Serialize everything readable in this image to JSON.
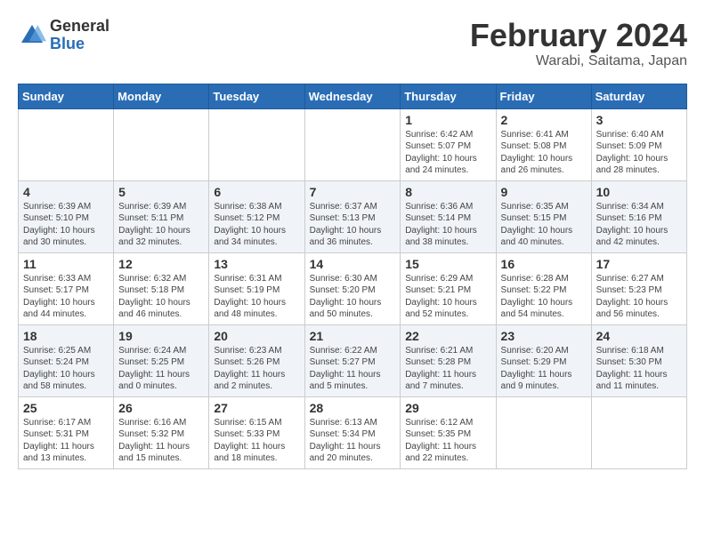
{
  "logo": {
    "general": "General",
    "blue": "Blue"
  },
  "title": "February 2024",
  "location": "Warabi, Saitama, Japan",
  "days_header": [
    "Sunday",
    "Monday",
    "Tuesday",
    "Wednesday",
    "Thursday",
    "Friday",
    "Saturday"
  ],
  "weeks": [
    [
      {
        "day": "",
        "info": ""
      },
      {
        "day": "",
        "info": ""
      },
      {
        "day": "",
        "info": ""
      },
      {
        "day": "",
        "info": ""
      },
      {
        "day": "1",
        "info": "Sunrise: 6:42 AM\nSunset: 5:07 PM\nDaylight: 10 hours\nand 24 minutes."
      },
      {
        "day": "2",
        "info": "Sunrise: 6:41 AM\nSunset: 5:08 PM\nDaylight: 10 hours\nand 26 minutes."
      },
      {
        "day": "3",
        "info": "Sunrise: 6:40 AM\nSunset: 5:09 PM\nDaylight: 10 hours\nand 28 minutes."
      }
    ],
    [
      {
        "day": "4",
        "info": "Sunrise: 6:39 AM\nSunset: 5:10 PM\nDaylight: 10 hours\nand 30 minutes."
      },
      {
        "day": "5",
        "info": "Sunrise: 6:39 AM\nSunset: 5:11 PM\nDaylight: 10 hours\nand 32 minutes."
      },
      {
        "day": "6",
        "info": "Sunrise: 6:38 AM\nSunset: 5:12 PM\nDaylight: 10 hours\nand 34 minutes."
      },
      {
        "day": "7",
        "info": "Sunrise: 6:37 AM\nSunset: 5:13 PM\nDaylight: 10 hours\nand 36 minutes."
      },
      {
        "day": "8",
        "info": "Sunrise: 6:36 AM\nSunset: 5:14 PM\nDaylight: 10 hours\nand 38 minutes."
      },
      {
        "day": "9",
        "info": "Sunrise: 6:35 AM\nSunset: 5:15 PM\nDaylight: 10 hours\nand 40 minutes."
      },
      {
        "day": "10",
        "info": "Sunrise: 6:34 AM\nSunset: 5:16 PM\nDaylight: 10 hours\nand 42 minutes."
      }
    ],
    [
      {
        "day": "11",
        "info": "Sunrise: 6:33 AM\nSunset: 5:17 PM\nDaylight: 10 hours\nand 44 minutes."
      },
      {
        "day": "12",
        "info": "Sunrise: 6:32 AM\nSunset: 5:18 PM\nDaylight: 10 hours\nand 46 minutes."
      },
      {
        "day": "13",
        "info": "Sunrise: 6:31 AM\nSunset: 5:19 PM\nDaylight: 10 hours\nand 48 minutes."
      },
      {
        "day": "14",
        "info": "Sunrise: 6:30 AM\nSunset: 5:20 PM\nDaylight: 10 hours\nand 50 minutes."
      },
      {
        "day": "15",
        "info": "Sunrise: 6:29 AM\nSunset: 5:21 PM\nDaylight: 10 hours\nand 52 minutes."
      },
      {
        "day": "16",
        "info": "Sunrise: 6:28 AM\nSunset: 5:22 PM\nDaylight: 10 hours\nand 54 minutes."
      },
      {
        "day": "17",
        "info": "Sunrise: 6:27 AM\nSunset: 5:23 PM\nDaylight: 10 hours\nand 56 minutes."
      }
    ],
    [
      {
        "day": "18",
        "info": "Sunrise: 6:25 AM\nSunset: 5:24 PM\nDaylight: 10 hours\nand 58 minutes."
      },
      {
        "day": "19",
        "info": "Sunrise: 6:24 AM\nSunset: 5:25 PM\nDaylight: 11 hours\nand 0 minutes."
      },
      {
        "day": "20",
        "info": "Sunrise: 6:23 AM\nSunset: 5:26 PM\nDaylight: 11 hours\nand 2 minutes."
      },
      {
        "day": "21",
        "info": "Sunrise: 6:22 AM\nSunset: 5:27 PM\nDaylight: 11 hours\nand 5 minutes."
      },
      {
        "day": "22",
        "info": "Sunrise: 6:21 AM\nSunset: 5:28 PM\nDaylight: 11 hours\nand 7 minutes."
      },
      {
        "day": "23",
        "info": "Sunrise: 6:20 AM\nSunset: 5:29 PM\nDaylight: 11 hours\nand 9 minutes."
      },
      {
        "day": "24",
        "info": "Sunrise: 6:18 AM\nSunset: 5:30 PM\nDaylight: 11 hours\nand 11 minutes."
      }
    ],
    [
      {
        "day": "25",
        "info": "Sunrise: 6:17 AM\nSunset: 5:31 PM\nDaylight: 11 hours\nand 13 minutes."
      },
      {
        "day": "26",
        "info": "Sunrise: 6:16 AM\nSunset: 5:32 PM\nDaylight: 11 hours\nand 15 minutes."
      },
      {
        "day": "27",
        "info": "Sunrise: 6:15 AM\nSunset: 5:33 PM\nDaylight: 11 hours\nand 18 minutes."
      },
      {
        "day": "28",
        "info": "Sunrise: 6:13 AM\nSunset: 5:34 PM\nDaylight: 11 hours\nand 20 minutes."
      },
      {
        "day": "29",
        "info": "Sunrise: 6:12 AM\nSunset: 5:35 PM\nDaylight: 11 hours\nand 22 minutes."
      },
      {
        "day": "",
        "info": ""
      },
      {
        "day": "",
        "info": ""
      }
    ]
  ]
}
